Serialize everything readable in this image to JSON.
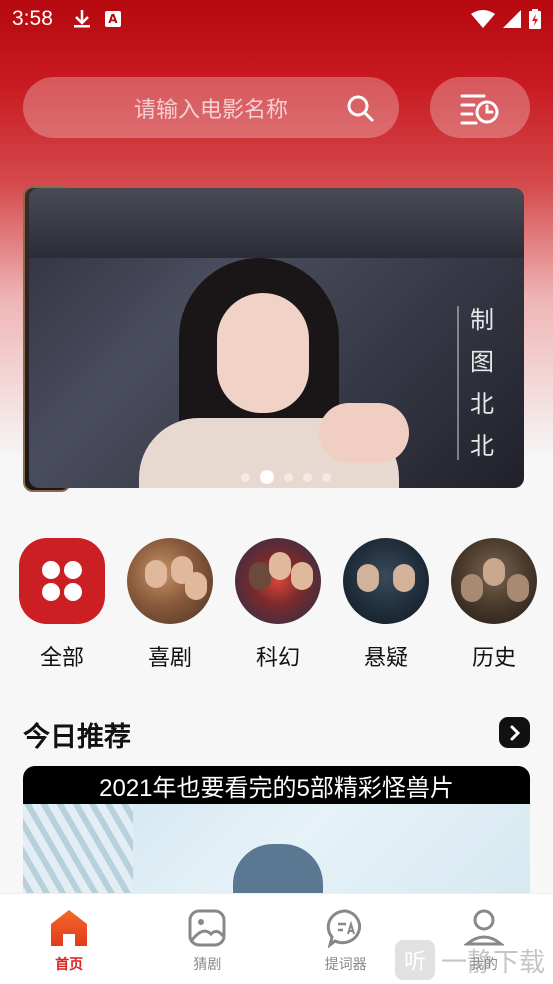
{
  "status_bar": {
    "time": "3:58",
    "notification_a": "A"
  },
  "search": {
    "placeholder": "请输入电影名称"
  },
  "banner": {
    "caption_chars": [
      "制",
      "图",
      "北",
      "北"
    ],
    "dot_count": 5,
    "active_dot_index": 1
  },
  "categories": [
    {
      "label": "全部",
      "icon": "all-grid-icon"
    },
    {
      "label": "喜剧",
      "icon": "comedy-poster"
    },
    {
      "label": "科幻",
      "icon": "scifi-poster"
    },
    {
      "label": "悬疑",
      "icon": "mystery-poster"
    },
    {
      "label": "历史",
      "icon": "history-poster"
    }
  ],
  "today": {
    "title": "今日推荐",
    "card_title": "2021年也要看完的5部精彩怪兽片"
  },
  "nav": {
    "home": "首页",
    "guess": "猜剧",
    "prompter": "提词器",
    "mine": "我的"
  },
  "watermark": {
    "badge": "听",
    "text": "一静下载"
  },
  "colors": {
    "brand": "#cc1f24",
    "active_nav": "#d6241f"
  }
}
